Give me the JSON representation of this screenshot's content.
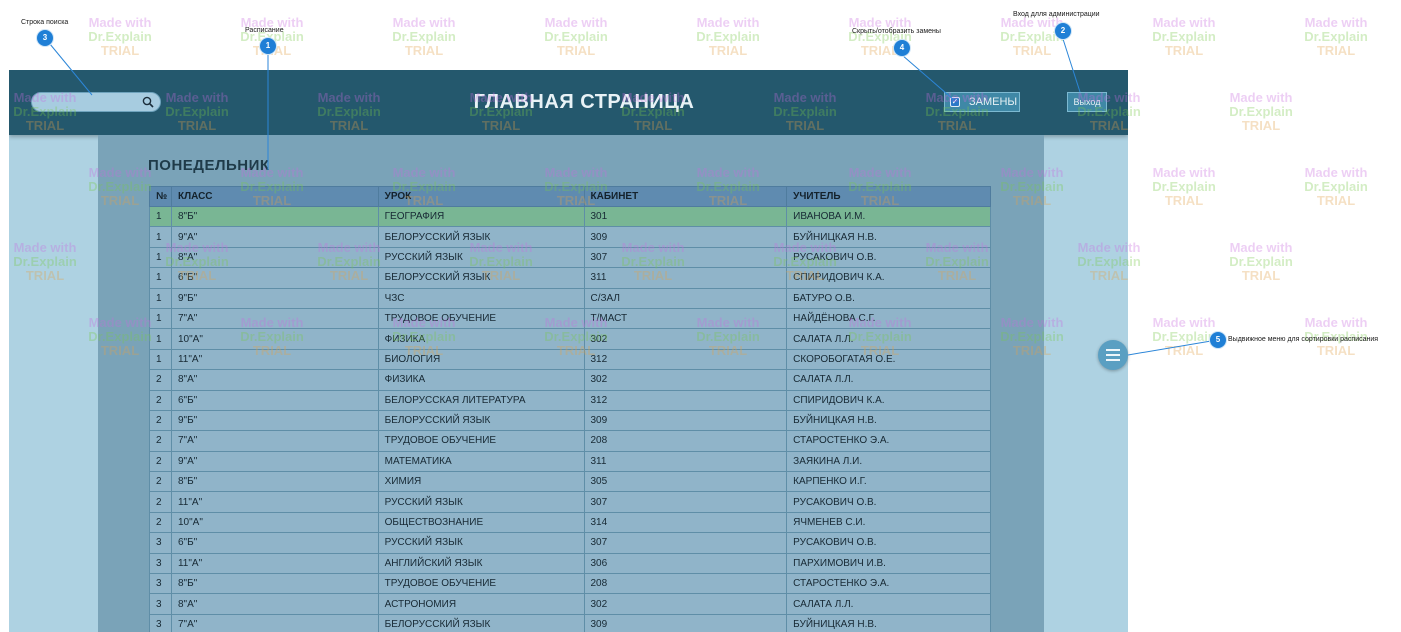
{
  "watermark": {
    "line1": "Made with",
    "line2": "Dr.Explain",
    "line3": "TRIAL"
  },
  "header": {
    "title": "ГЛАВНАЯ СТРАНИЦА",
    "search_placeholder": "",
    "search_icon": "search-icon",
    "replacements_label": "ЗАМЕНЫ",
    "replacements_checked": true,
    "exit_label": "Выход"
  },
  "schedule": {
    "day": "ПОНЕДЕЛЬНИК",
    "columns": [
      "№",
      "КЛАСС",
      "УРОК",
      "КАБИНЕТ",
      "УЧИТЕЛЬ"
    ],
    "rows": [
      [
        "1",
        "8\"Б\"",
        "ГЕОГРАФИЯ",
        "301",
        "ИВАНОВА И.М."
      ],
      [
        "1",
        "9\"А\"",
        "БЕЛОРУССКИЙ ЯЗЫК",
        "309",
        "БУЙНИЦКАЯ Н.В."
      ],
      [
        "1",
        "8\"А\"",
        "РУССКИЙ ЯЗЫК",
        "307",
        "РУСАКОВИЧ О.В."
      ],
      [
        "1",
        "6\"Б\"",
        "БЕЛОРУССКИЙ ЯЗЫК",
        "311",
        "СПИРИДОВИЧ К.А."
      ],
      [
        "1",
        "9\"Б\"",
        "ЧЗС",
        "С/ЗАЛ",
        "БАТУРО О.В."
      ],
      [
        "1",
        "7\"А\"",
        "ТРУДОВОЕ ОБУЧЕНИЕ",
        "Т/МАСТ",
        "НАЙДЁНОВА С.Г."
      ],
      [
        "1",
        "10\"А\"",
        "ФИЗИКА",
        "302",
        "САЛАТА Л.Л."
      ],
      [
        "1",
        "11\"А\"",
        "БИОЛОГИЯ",
        "312",
        "СКОРОБОГАТАЯ О.Е."
      ],
      [
        "2",
        "8\"А\"",
        "ФИЗИКА",
        "302",
        "САЛАТА Л.Л."
      ],
      [
        "2",
        "6\"Б\"",
        "БЕЛОРУССКАЯ ЛИТЕРАТУРА",
        "312",
        "СПИРИДОВИЧ К.А."
      ],
      [
        "2",
        "9\"Б\"",
        "БЕЛОРУССКИЙ ЯЗЫК",
        "309",
        "БУЙНИЦКАЯ Н.В."
      ],
      [
        "2",
        "7\"А\"",
        "ТРУДОВОЕ ОБУЧЕНИЕ",
        "208",
        "СТАРОСТЕНКО Э.А."
      ],
      [
        "2",
        "9\"А\"",
        "МАТЕМАТИКА",
        "311",
        "ЗАЯКИНА Л.И."
      ],
      [
        "2",
        "8\"Б\"",
        "ХИМИЯ",
        "305",
        "КАРПЕНКО И.Г."
      ],
      [
        "2",
        "11\"А\"",
        "РУССКИЙ ЯЗЫК",
        "307",
        "РУСАКОВИЧ О.В."
      ],
      [
        "2",
        "10\"А\"",
        "ОБЩЕСТВОЗНАНИЕ",
        "314",
        "ЯЧМЕНЕВ С.И."
      ],
      [
        "3",
        "6\"Б\"",
        "РУССКИЙ ЯЗЫК",
        "307",
        "РУСАКОВИЧ О.В."
      ],
      [
        "3",
        "11\"А\"",
        "АНГЛИЙСКИЙ ЯЗЫК",
        "306",
        "ПАРХИМОВИЧ И.В."
      ],
      [
        "3",
        "8\"Б\"",
        "ТРУДОВОЕ ОБУЧЕНИЕ",
        "208",
        "СТАРОСТЕНКО Э.А."
      ],
      [
        "3",
        "8\"А\"",
        "АСТРОНОМИЯ",
        "302",
        "САЛАТА Л.Л."
      ],
      [
        "3",
        "7\"А\"",
        "БЕЛОРУССКИЙ ЯЗЫК",
        "309",
        "БУЙНИЦКАЯ Н.В."
      ]
    ]
  },
  "menu_button": {
    "icon": "menu-icon"
  },
  "annotations": [
    {
      "number": "1",
      "text": "Расписание"
    },
    {
      "number": "2",
      "text": "Вход длля администрации"
    },
    {
      "number": "3",
      "text": "Строка поиска"
    },
    {
      "number": "4",
      "text": "Скрыть/отобразить замены"
    },
    {
      "number": "5",
      "text": "Выдвижное меню для сортировки расписания"
    }
  ],
  "colors": {
    "header": "#24586d",
    "background": "#aed2e2",
    "highlight_row": "#79b694",
    "badge": "#1f7fd6"
  }
}
